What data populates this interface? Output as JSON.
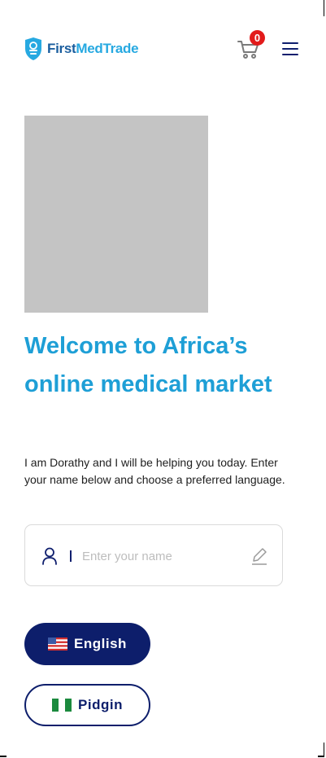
{
  "header": {
    "logo_first": "First",
    "logo_rest": "MedTrade",
    "cart_count": "0",
    "icons": {
      "cart": "cart-icon",
      "menu": "hamburger-menu-icon",
      "logo": "shield-logo-icon"
    }
  },
  "hero": {
    "title": "Welcome to Africa’s online medical market",
    "description": "I am Dorathy and I will be helping you today. Enter your name below and choose a preferred language."
  },
  "name_field": {
    "value": "",
    "placeholder": "Enter your name",
    "icons": {
      "left": "user-icon",
      "right": "pencil-icon"
    }
  },
  "languages": [
    {
      "label": "English",
      "flag": "us-flag-icon",
      "selected": true
    },
    {
      "label": "Pidgin",
      "flag": "nigeria-flag-icon",
      "selected": false
    }
  ],
  "colors": {
    "brand_dark": "#0D1E6B",
    "brand_light": "#1E9FD6",
    "badge": "#E21B1B",
    "image_placeholder": "#C4C4C4"
  }
}
